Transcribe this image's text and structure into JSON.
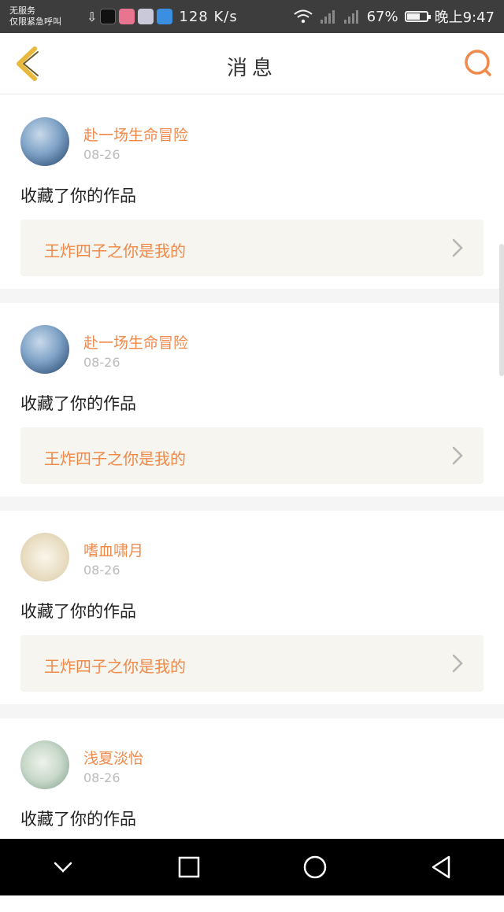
{
  "status_bar": {
    "carrier_line1": "无服务",
    "carrier_line2": "仅限紧急呼叫",
    "speed": "128 K/s",
    "battery": "67%",
    "battery_level": 0.67,
    "time": "晚上9:47"
  },
  "navbar": {
    "title": "消息",
    "back_icon": "chevron-left-icon",
    "search_icon": "search-icon",
    "accent": "#f08a4b"
  },
  "messages": [
    {
      "user": "赴一场生命冒险",
      "date": "08-26",
      "action": "收藏了你的作品",
      "work": "王炸四子之你是我的"
    },
    {
      "user": "赴一场生命冒险",
      "date": "08-26",
      "action": "收藏了你的作品",
      "work": "王炸四子之你是我的"
    },
    {
      "user": "嗜血啸月",
      "date": "08-26",
      "action": "收藏了你的作品",
      "work": "王炸四子之你是我的"
    },
    {
      "user": "浅夏淡怡",
      "date": "08-26",
      "action": "收藏了你的作品"
    }
  ],
  "system_nav": {
    "icons": [
      "chevron-down-icon",
      "square-icon",
      "circle-icon",
      "triangle-back-icon"
    ]
  }
}
